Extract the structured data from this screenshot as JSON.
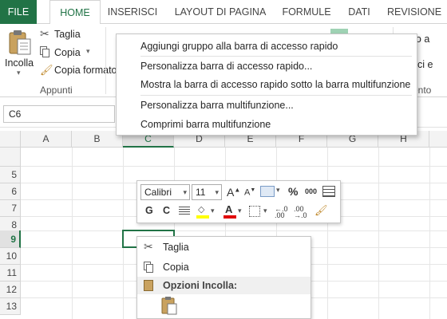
{
  "tabs": [
    "FILE",
    "HOME",
    "INSERISCI",
    "LAYOUT DI PAGINA",
    "FORMULE",
    "DATI",
    "REVISIONE"
  ],
  "ribbon": {
    "paste_label": "Incolla",
    "cut_label": "Taglia",
    "copy_label": "Copia",
    "format_painter_label": "Copia formato",
    "clipboard_group": "Appunti",
    "wrap_text": "Testo a",
    "merge": "Unisci e",
    "alignment_group_partial": "ento"
  },
  "namebox_value": "C6",
  "columns": [
    "A",
    "B",
    "C",
    "D",
    "E",
    "F",
    "G",
    "H"
  ],
  "selected_column": "C",
  "rows": [
    "5",
    "6",
    "7",
    "8",
    "9",
    "10",
    "11",
    "12",
    "13"
  ],
  "selected_row": "9",
  "qat_menu": {
    "items": [
      "Aggiungi gruppo alla barra di accesso rapido",
      "Personalizza barra di accesso rapido...",
      "Mostra la barra di accesso rapido sotto la barra multifunzione",
      "Personalizza barra multifunzione...",
      "Comprimi barra multifunzione"
    ]
  },
  "mini_toolbar": {
    "font": "Calibri",
    "size": "11",
    "bold": "G",
    "italic": "C",
    "percent": "%",
    "thousands": "000",
    "grow": "A",
    "shrink": "A",
    "font_color": "A"
  },
  "context_menu": {
    "cut": "Taglia",
    "copy": "Copia",
    "paste_options": "Opzioni Incolla:"
  },
  "colors": {
    "excel_green": "#217346",
    "highlight_yellow": "#ffff00",
    "font_red": "#e00000"
  }
}
